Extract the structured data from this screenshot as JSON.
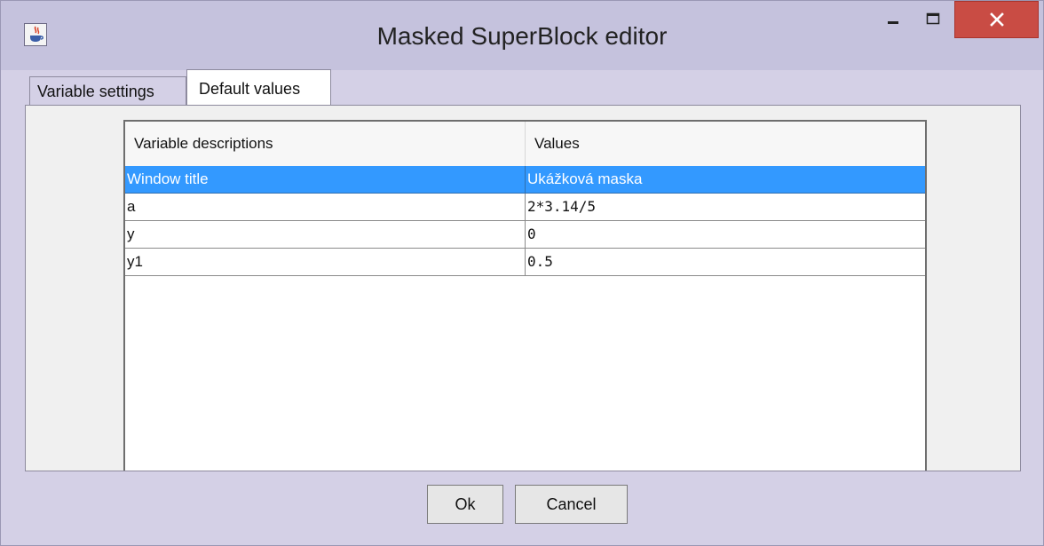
{
  "window": {
    "title": "Masked SuperBlock editor",
    "icons": {
      "app": "java-app-icon",
      "minimize": "minimize-icon",
      "maximize": "maximize-icon",
      "close": "close-icon"
    },
    "colors": {
      "titlebar": "#c5c2dd",
      "close_button": "#c94c44",
      "selection": "#3399ff"
    }
  },
  "tabs": [
    {
      "label": "Variable settings",
      "active": false
    },
    {
      "label": "Default values",
      "active": true
    }
  ],
  "table": {
    "columns": [
      "Variable descriptions",
      "Values"
    ],
    "rows": [
      {
        "description": "Window title",
        "value": "Ukážková maska",
        "selected": true
      },
      {
        "description": "a",
        "value": "2*3.14/5",
        "selected": false
      },
      {
        "description": "y",
        "value": "0",
        "selected": false
      },
      {
        "description": "y1",
        "value": "0.5",
        "selected": false
      }
    ]
  },
  "buttons": {
    "ok": "Ok",
    "cancel": "Cancel"
  }
}
